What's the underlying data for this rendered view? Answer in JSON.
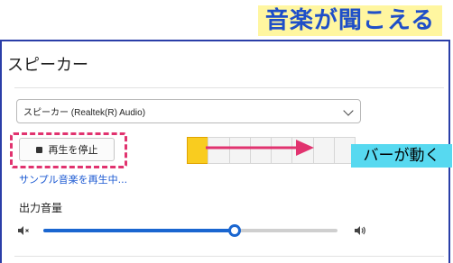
{
  "annotation": {
    "heading": "音楽が聞こえる",
    "callout": "バーが動く",
    "highlight_color": "#e1336f",
    "arrow_color": "#e1336f"
  },
  "speaker_section": {
    "title": "スピーカー",
    "device_select": {
      "selected": "スピーカー (Realtek(R) Audio)"
    },
    "stop_button_label": "再生を停止",
    "level_meter": {
      "segments": 8,
      "active_segments": 1,
      "active_color": "#f9cc1f"
    },
    "playing_status": "サンプル音楽を再生中..."
  },
  "volume": {
    "label": "出力音量",
    "value_fraction": 0.65,
    "accent": "#1a66d0"
  }
}
